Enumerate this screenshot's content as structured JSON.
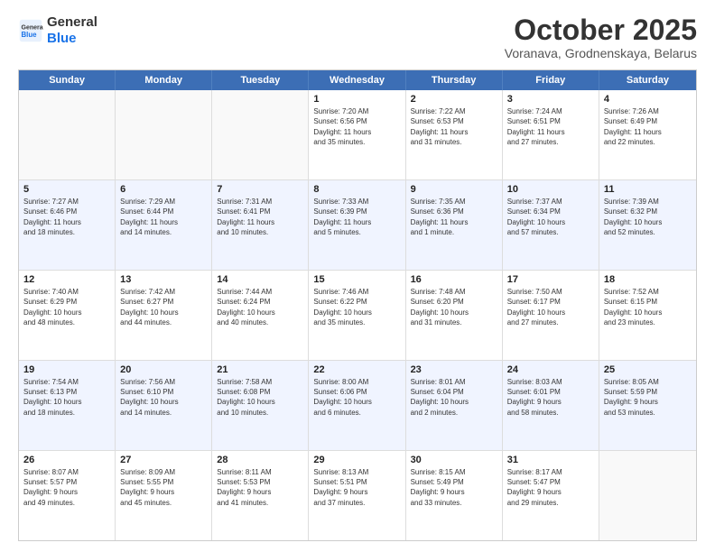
{
  "header": {
    "logo": {
      "line1": "General",
      "line2": "Blue"
    },
    "title": "October 2025",
    "location": "Voranava, Grodnenskaya, Belarus"
  },
  "calendar": {
    "days_of_week": [
      "Sunday",
      "Monday",
      "Tuesday",
      "Wednesday",
      "Thursday",
      "Friday",
      "Saturday"
    ],
    "rows": [
      {
        "shaded": false,
        "cells": [
          {
            "day": "",
            "info": ""
          },
          {
            "day": "",
            "info": ""
          },
          {
            "day": "",
            "info": ""
          },
          {
            "day": "1",
            "info": "Sunrise: 7:20 AM\nSunset: 6:56 PM\nDaylight: 11 hours\nand 35 minutes."
          },
          {
            "day": "2",
            "info": "Sunrise: 7:22 AM\nSunset: 6:53 PM\nDaylight: 11 hours\nand 31 minutes."
          },
          {
            "day": "3",
            "info": "Sunrise: 7:24 AM\nSunset: 6:51 PM\nDaylight: 11 hours\nand 27 minutes."
          },
          {
            "day": "4",
            "info": "Sunrise: 7:26 AM\nSunset: 6:49 PM\nDaylight: 11 hours\nand 22 minutes."
          }
        ]
      },
      {
        "shaded": true,
        "cells": [
          {
            "day": "5",
            "info": "Sunrise: 7:27 AM\nSunset: 6:46 PM\nDaylight: 11 hours\nand 18 minutes."
          },
          {
            "day": "6",
            "info": "Sunrise: 7:29 AM\nSunset: 6:44 PM\nDaylight: 11 hours\nand 14 minutes."
          },
          {
            "day": "7",
            "info": "Sunrise: 7:31 AM\nSunset: 6:41 PM\nDaylight: 11 hours\nand 10 minutes."
          },
          {
            "day": "8",
            "info": "Sunrise: 7:33 AM\nSunset: 6:39 PM\nDaylight: 11 hours\nand 5 minutes."
          },
          {
            "day": "9",
            "info": "Sunrise: 7:35 AM\nSunset: 6:36 PM\nDaylight: 11 hours\nand 1 minute."
          },
          {
            "day": "10",
            "info": "Sunrise: 7:37 AM\nSunset: 6:34 PM\nDaylight: 10 hours\nand 57 minutes."
          },
          {
            "day": "11",
            "info": "Sunrise: 7:39 AM\nSunset: 6:32 PM\nDaylight: 10 hours\nand 52 minutes."
          }
        ]
      },
      {
        "shaded": false,
        "cells": [
          {
            "day": "12",
            "info": "Sunrise: 7:40 AM\nSunset: 6:29 PM\nDaylight: 10 hours\nand 48 minutes."
          },
          {
            "day": "13",
            "info": "Sunrise: 7:42 AM\nSunset: 6:27 PM\nDaylight: 10 hours\nand 44 minutes."
          },
          {
            "day": "14",
            "info": "Sunrise: 7:44 AM\nSunset: 6:24 PM\nDaylight: 10 hours\nand 40 minutes."
          },
          {
            "day": "15",
            "info": "Sunrise: 7:46 AM\nSunset: 6:22 PM\nDaylight: 10 hours\nand 35 minutes."
          },
          {
            "day": "16",
            "info": "Sunrise: 7:48 AM\nSunset: 6:20 PM\nDaylight: 10 hours\nand 31 minutes."
          },
          {
            "day": "17",
            "info": "Sunrise: 7:50 AM\nSunset: 6:17 PM\nDaylight: 10 hours\nand 27 minutes."
          },
          {
            "day": "18",
            "info": "Sunrise: 7:52 AM\nSunset: 6:15 PM\nDaylight: 10 hours\nand 23 minutes."
          }
        ]
      },
      {
        "shaded": true,
        "cells": [
          {
            "day": "19",
            "info": "Sunrise: 7:54 AM\nSunset: 6:13 PM\nDaylight: 10 hours\nand 18 minutes."
          },
          {
            "day": "20",
            "info": "Sunrise: 7:56 AM\nSunset: 6:10 PM\nDaylight: 10 hours\nand 14 minutes."
          },
          {
            "day": "21",
            "info": "Sunrise: 7:58 AM\nSunset: 6:08 PM\nDaylight: 10 hours\nand 10 minutes."
          },
          {
            "day": "22",
            "info": "Sunrise: 8:00 AM\nSunset: 6:06 PM\nDaylight: 10 hours\nand 6 minutes."
          },
          {
            "day": "23",
            "info": "Sunrise: 8:01 AM\nSunset: 6:04 PM\nDaylight: 10 hours\nand 2 minutes."
          },
          {
            "day": "24",
            "info": "Sunrise: 8:03 AM\nSunset: 6:01 PM\nDaylight: 9 hours\nand 58 minutes."
          },
          {
            "day": "25",
            "info": "Sunrise: 8:05 AM\nSunset: 5:59 PM\nDaylight: 9 hours\nand 53 minutes."
          }
        ]
      },
      {
        "shaded": false,
        "cells": [
          {
            "day": "26",
            "info": "Sunrise: 8:07 AM\nSunset: 5:57 PM\nDaylight: 9 hours\nand 49 minutes."
          },
          {
            "day": "27",
            "info": "Sunrise: 8:09 AM\nSunset: 5:55 PM\nDaylight: 9 hours\nand 45 minutes."
          },
          {
            "day": "28",
            "info": "Sunrise: 8:11 AM\nSunset: 5:53 PM\nDaylight: 9 hours\nand 41 minutes."
          },
          {
            "day": "29",
            "info": "Sunrise: 8:13 AM\nSunset: 5:51 PM\nDaylight: 9 hours\nand 37 minutes."
          },
          {
            "day": "30",
            "info": "Sunrise: 8:15 AM\nSunset: 5:49 PM\nDaylight: 9 hours\nand 33 minutes."
          },
          {
            "day": "31",
            "info": "Sunrise: 8:17 AM\nSunset: 5:47 PM\nDaylight: 9 hours\nand 29 minutes."
          },
          {
            "day": "",
            "info": ""
          }
        ]
      }
    ]
  }
}
